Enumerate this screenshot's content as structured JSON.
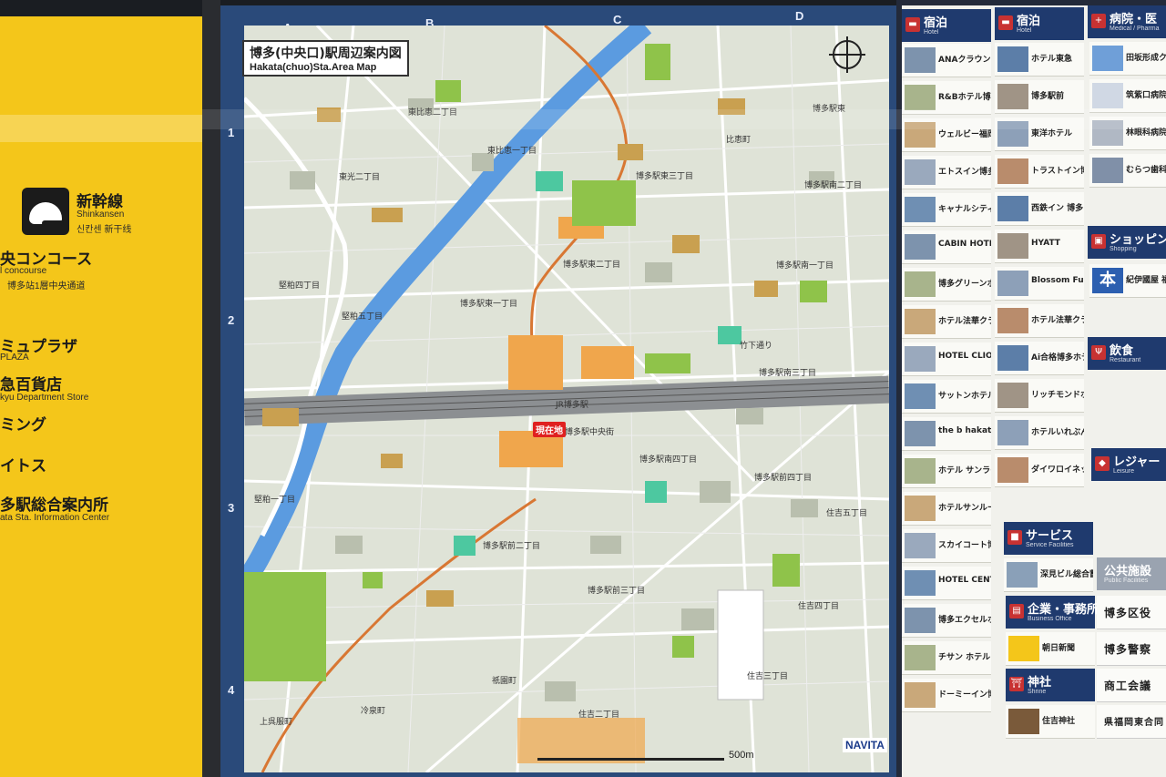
{
  "left_panel": {
    "shinkansen": {
      "jp": "新幹線",
      "en": "Shinkansen",
      "kr": "신칸센   新干线"
    },
    "concourse": {
      "jp": "央コンコース",
      "en": "l concourse",
      "sub": "博多站1層中央通道"
    },
    "plaza": {
      "jp": "ミュプラザ",
      "en": "PLAZA"
    },
    "dept": {
      "jp": "急百貨店",
      "en": "kyu Department Store"
    },
    "ming": {
      "jp": "ミング"
    },
    "its": {
      "jp": "イトス"
    },
    "info": {
      "jp": "多駅総合案内所",
      "en": "ata Sta. Information Center"
    }
  },
  "map": {
    "title_jp": "博多(中央口)駅周辺案内図",
    "title_en": "Hakata(chuo)Sta.Area Map",
    "columns": [
      "A",
      "B",
      "C",
      "D"
    ],
    "rows": [
      "1",
      "2",
      "3",
      "4"
    ],
    "here_label": "現在地",
    "scale_label": "500m",
    "brand": "NAVITA",
    "labels": {
      "l1": "東比恵二丁目",
      "l2": "東比恵一丁目",
      "l3": "博多駅東三丁目",
      "l4": "博多駅南二丁目",
      "l5": "博多駅東二丁目",
      "l6": "博多駅東一丁目",
      "l7": "博多駅南一丁目",
      "l8": "博多駅前四丁目",
      "l9": "博多駅前二丁目",
      "l10": "博多駅前三丁目",
      "l11": "住吉五丁目",
      "l12": "住吉四丁目",
      "l13": "住吉三丁目",
      "l14": "祇園町",
      "l15": "冷泉町",
      "l16": "比恵町",
      "l17": "博多駅東",
      "l18": "JR博多駅",
      "l19": "博多駅中央街",
      "l20": "住吉二丁目",
      "l21": "東光二丁目",
      "l22": "堅粕四丁目",
      "l23": "堅粕五丁目",
      "l24": "堅粕一丁目",
      "l25": "上呉服町",
      "l26": "博多駅南三丁目",
      "l27": "竹下通り",
      "l28": "博多駅南四丁目"
    }
  },
  "directory": {
    "headers": [
      {
        "icon": "bed",
        "jp": "宿泊",
        "en": "Hotel"
      },
      {
        "icon": "bed",
        "jp": "宿泊",
        "en": "Hotel"
      },
      {
        "icon": "hospital",
        "jp": "病院・医",
        "en": "Medical / Pharma"
      }
    ],
    "col1": [
      "ANAクラウンプラザ",
      "R&Bホテル博多駅前",
      "ウェルビー福岡",
      "エトスイン博多",
      "キャナルシティ",
      "CABIN HOTEL",
      "博多グリーンホテル",
      "ホテル法華クラブ",
      "HOTEL CLIO COURT",
      "サットンホテル博多",
      "the b hakata",
      "ホテル サンライン",
      "ホテルサンルート",
      "スカイコート博多",
      "HOTEL CENTURY ART",
      "博多エクセルホテル東急",
      "チサン ホテル 博多",
      "ドーミーイン博多"
    ],
    "col2": [
      "ホテル東急",
      "博多駅前",
      "東洋ホテル",
      "トラストイン博多",
      "西鉄イン 博多",
      "HYATT",
      "Blossom Fukuoka",
      "ホテル法華クラブ",
      "Ai合格博多ホテル",
      "リッチモンドホテル",
      "ホテルいれぶん",
      "ダイワロイネット"
    ],
    "col3": [
      "田坂形成クリニック",
      "筑紫口病院",
      "林眼科病院",
      "むらつ歯科"
    ],
    "shopping": {
      "jp": "ショッピン",
      "en": "Shopping"
    },
    "book": {
      "jp": "本",
      "name": "紀伊國屋 福岡"
    },
    "restaurant": {
      "jp": "飲食",
      "en": "Restaurant"
    },
    "leisure": {
      "jp": "レジャー",
      "en": "Leisure"
    },
    "service": {
      "jp": "サービス",
      "en": "Service Facilities",
      "item": "深見ビル総合蓄電室"
    },
    "business": {
      "jp": "企業・事務所",
      "en": "Business Office",
      "item": "朝日新聞"
    },
    "shrine": {
      "jp": "神社",
      "en": "Shrine",
      "item": "住吉神社"
    },
    "public": {
      "jp": "公共施設",
      "en": "Public Facilities",
      "items": [
        "博多区役",
        "博多警察",
        "商工会議",
        "県福岡東合同"
      ]
    }
  }
}
